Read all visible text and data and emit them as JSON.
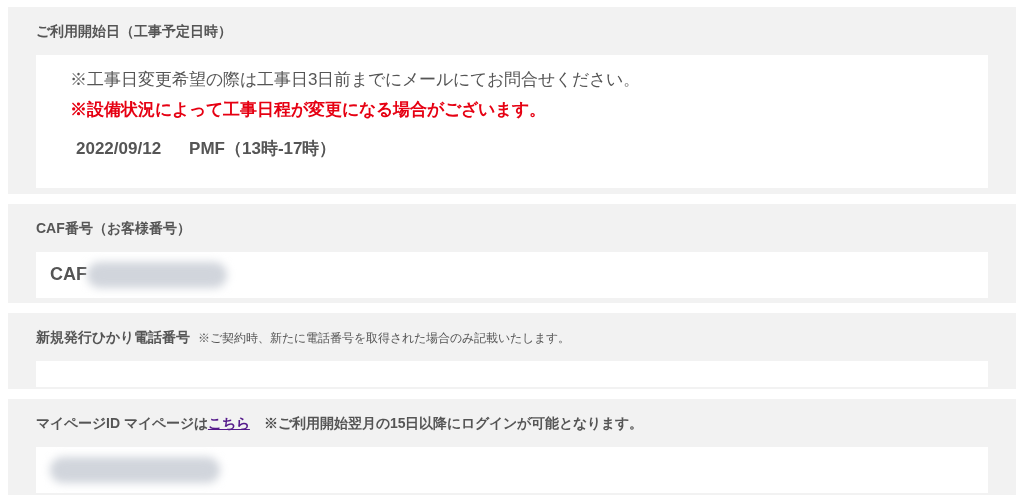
{
  "sections": [
    {
      "kind": "schedule",
      "label": "ご利用開始日（工事予定日時）",
      "notes": [
        {
          "text": "※工事日変更希望の際は工事日3日前までにメールにてお問合せください。",
          "emphasis": false
        },
        {
          "text": "※設備状況によって工事日程が変更になる場合がございます。",
          "emphasis": true
        }
      ],
      "date": "2022/09/12",
      "time": "PMF（13時-17時）"
    },
    {
      "kind": "field",
      "label": "CAF番号（お客様番号）",
      "value": "CAF",
      "redacted": true
    },
    {
      "kind": "field",
      "label": "新規発行ひかり電話番号",
      "hint": "※ご契約時、新たに電話番号を取得された場合のみ記載いたします。",
      "redacted": false
    },
    {
      "kind": "mypage",
      "label": "マイページID マイページは",
      "link": "こちら",
      "note": "※ご利用開始翌月の15日以降にログインが可能となります。",
      "redacted": true
    }
  ]
}
